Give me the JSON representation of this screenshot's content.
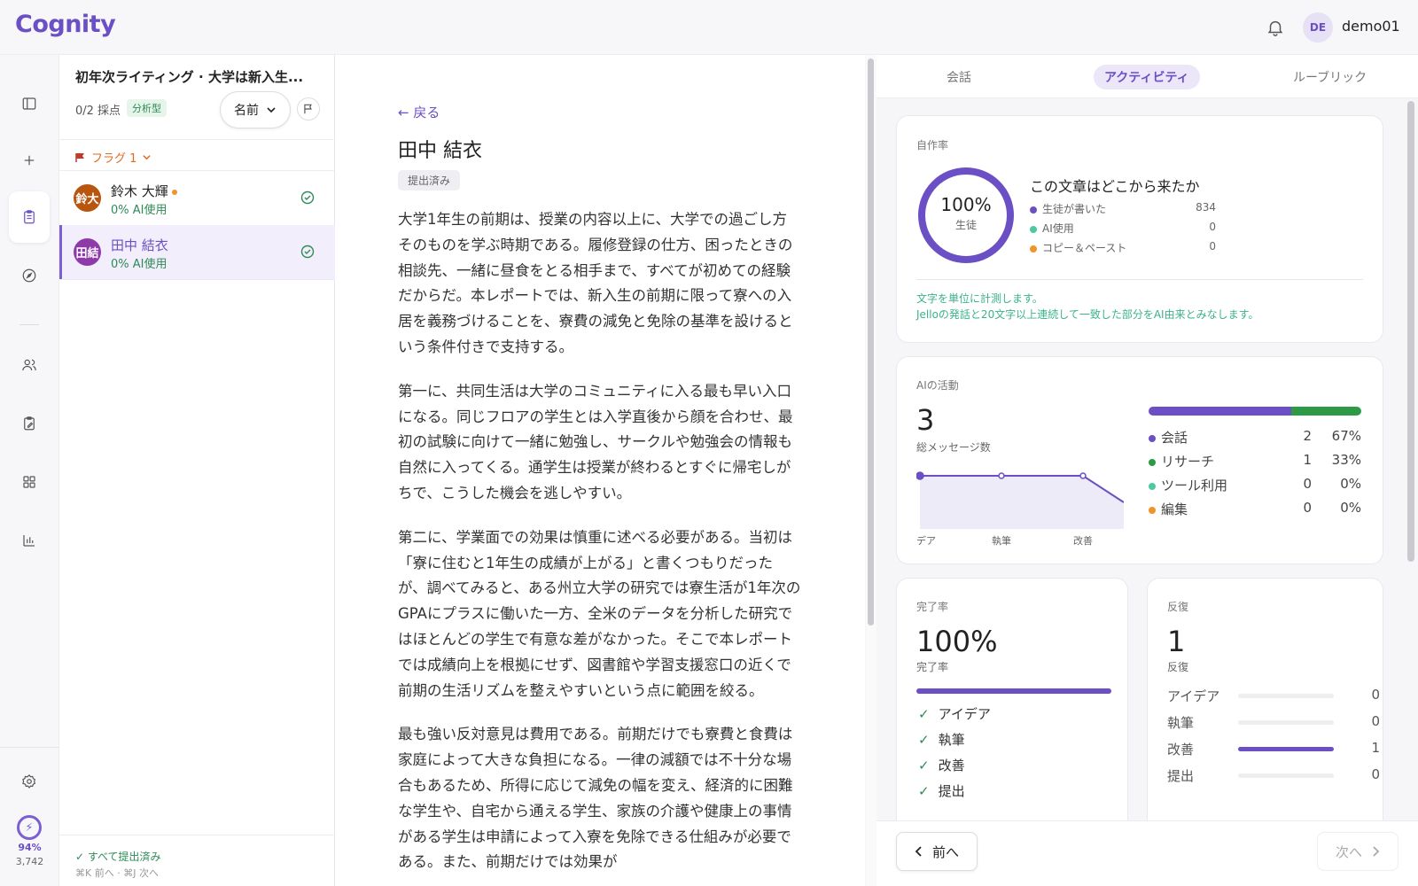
{
  "app": {
    "logo": "Cognity",
    "user_initials": "DE",
    "user_name": "demo01"
  },
  "rail": {
    "energy_pct": "94%",
    "energy_count": "3,742"
  },
  "list": {
    "assignment_title": "初年次ライティング · 大学は新入生...",
    "graded": "0/2 採点",
    "type_badge": "分析型",
    "sort_label": "名前",
    "flag_filter": "フラグ 1",
    "students": [
      {
        "initials": "鈴大",
        "name": "鈴木 大輝",
        "ai": "0% AI使用",
        "color": "#b8560f"
      },
      {
        "initials": "田結",
        "name": "田中 結衣",
        "ai": "0% AI使用",
        "color": "#8e3aa8"
      }
    ],
    "footer_status": "✓ すべて提出済み",
    "footer_shortcut": "⌘K 前へ · ⌘J 次へ"
  },
  "essay": {
    "back": "← 戻る",
    "student_name": "田中 結衣",
    "status": "提出済み",
    "paragraphs": [
      "大学1年生の前期は、授業の内容以上に、大学での過ごし方そのものを学ぶ時期である。履修登録の仕方、困ったときの相談先、一緒に昼食をとる相手まで、すべてが初めての経験だからだ。本レポートでは、新入生の前期に限って寮への入居を義務づけることを、寮費の減免と免除の基準を設けるという条件付きで支持する。",
      "第一に、共同生活は大学のコミュニティに入る最も早い入口になる。同じフロアの学生とは入学直後から顔を合わせ、最初の試験に向けて一緒に勉強し、サークルや勉強会の情報も自然に入ってくる。通学生は授業が終わるとすぐに帰宅しがちで、こうした機会を逃しやすい。",
      "第二に、学業面での効果は慎重に述べる必要がある。当初は「寮に住むと1年生の成績が上がる」と書くつもりだったが、調べてみると、ある州立大学の研究では寮生活が1年次のGPAにプラスに働いた一方、全米のデータを分析した研究ではほとんどの学生で有意な差がなかった。そこで本レポートでは成績向上を根拠にせず、図書館や学習支援窓口の近くで前期の生活リズムを整えやすいという点に範囲を絞る。",
      "最も強い反対意見は費用である。前期だけでも寮費と食費は家庭によって大きな負担になる。一律の減額では不十分な場合もあるため、所得に応じて減免の幅を変え、経済的に困難な学生や、自宅から通える学生、家族の介護や健康上の事情がある学生は申請によって入寮を免除できる仕組みが必要である。また、前期だけでは効果が"
    ]
  },
  "tabs": [
    "会話",
    "アクティビティ",
    "ルーブリック"
  ],
  "authorship": {
    "label": "自作率",
    "percent": "100%",
    "percent_sub": "生徒",
    "title": "この文章はどこから来たか",
    "sources": [
      {
        "name": "生徒が書いた",
        "value": "834",
        "color": "#6b4fc4"
      },
      {
        "name": "AI使用",
        "value": "0",
        "color": "#4cc9a0"
      },
      {
        "name": "コピー＆ペースト",
        "value": "0",
        "color": "#f0932b"
      }
    ],
    "note1": "文字を単位に計測します。",
    "note2": "Jelloの発話と20文字以上連続して一致した部分をAI由来とみなします。"
  },
  "ai_activity": {
    "label": "AIの活動",
    "total": "3",
    "total_label": "総メッセージ数",
    "chart_ticks": [
      "デア",
      "執筆",
      "改善"
    ],
    "chart_values": [
      1,
      1,
      1,
      0
    ],
    "breakdown": [
      {
        "name": "会話",
        "count": "2",
        "pct": "67%",
        "share": 0.67,
        "color": "#6b4fc4"
      },
      {
        "name": "リサーチ",
        "count": "1",
        "pct": "33%",
        "share": 0.33,
        "color": "#2e9a48"
      },
      {
        "name": "ツール利用",
        "count": "0",
        "pct": "0%",
        "share": 0,
        "color": "#4cc9a0"
      },
      {
        "name": "編集",
        "count": "0",
        "pct": "0%",
        "share": 0,
        "color": "#f0932b"
      }
    ]
  },
  "completion": {
    "label": "完了率",
    "value": "100%",
    "sub": "完了率",
    "fraction": 1.0,
    "steps": [
      "アイデア",
      "執筆",
      "改善",
      "提出"
    ]
  },
  "iteration": {
    "label": "反復",
    "value": "1",
    "sub": "反復",
    "rows": [
      {
        "name": "アイデア",
        "value": "0",
        "fraction": 0
      },
      {
        "name": "執筆",
        "value": "0",
        "fraction": 0
      },
      {
        "name": "改善",
        "value": "1",
        "fraction": 1
      },
      {
        "name": "提出",
        "value": "0",
        "fraction": 0
      }
    ]
  },
  "nav": {
    "prev": "前へ",
    "next": "次へ"
  }
}
